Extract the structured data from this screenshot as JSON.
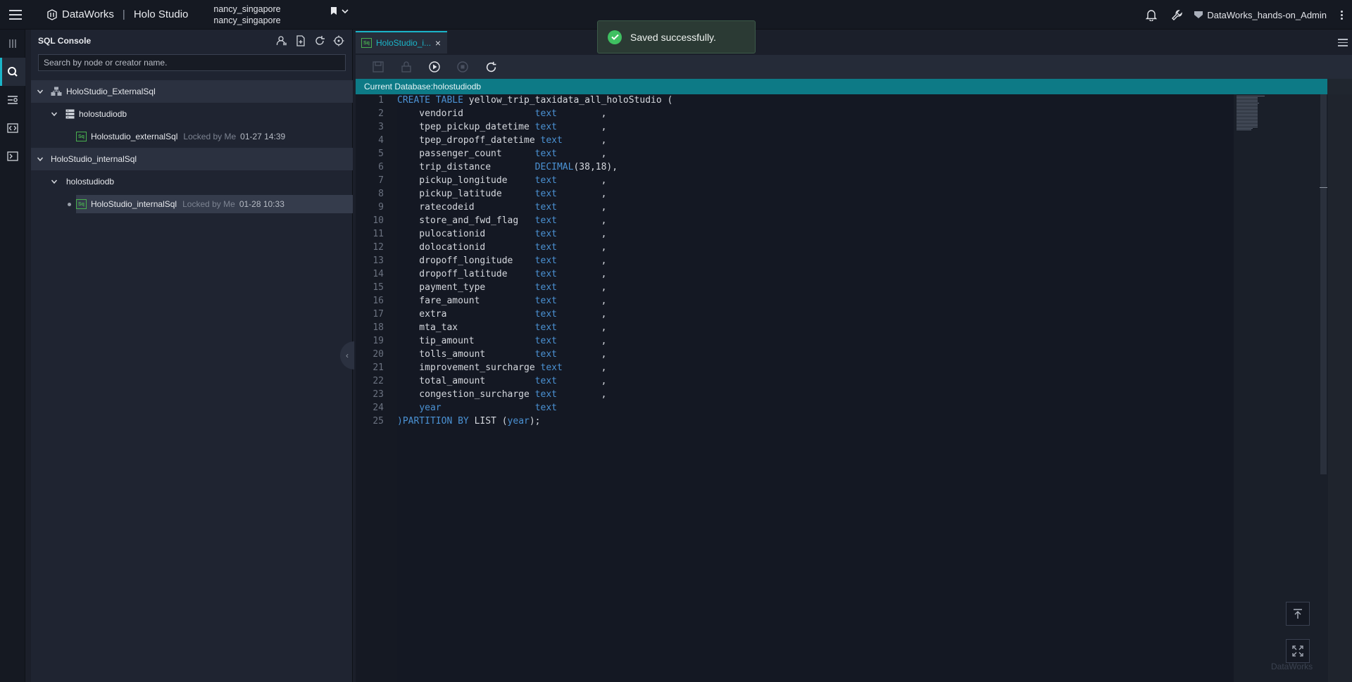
{
  "topbar": {
    "brand": "DataWorks",
    "product": "Holo Studio",
    "workspace_line1": "nancy_singapore",
    "workspace_line2": "nancy_singapore",
    "user": "DataWorks_hands-on_Admin"
  },
  "sidebar": {
    "title": "SQL Console",
    "search_placeholder": "Search by node or creator name."
  },
  "tree": {
    "group1": "HoloStudio_ExternalSql",
    "group1_db": "holostudiodb",
    "group1_file": "Holostudio_externalSql",
    "group1_file_lock": "Locked by Me",
    "group1_file_time": "01-27 14:39",
    "group2": "HoloStudio_internalSql",
    "group2_db": "holostudiodb",
    "group2_file": "HoloStudio_internalSql",
    "group2_file_lock": "Locked by Me",
    "group2_file_time": "01-28 10:33"
  },
  "editor": {
    "tab_label": "HoloStudio_i...",
    "current_database": "Current Database:holostudiodb"
  },
  "toast": {
    "message": "Saved successfully."
  },
  "watermark": "DataWorks",
  "code_lines": [
    {
      "n": "1",
      "parts": [
        {
          "t": "CREATE TABLE",
          "c": "kw"
        },
        {
          "t": " yellow_trip_taxidata_all_holoStudio ("
        }
      ]
    },
    {
      "n": "2",
      "parts": [
        {
          "t": "    vendorid             "
        },
        {
          "t": "text",
          "c": "ty"
        },
        {
          "t": "        ,"
        }
      ]
    },
    {
      "n": "3",
      "parts": [
        {
          "t": "    tpep_pickup_datetime "
        },
        {
          "t": "text",
          "c": "ty"
        },
        {
          "t": "        ,"
        }
      ]
    },
    {
      "n": "4",
      "parts": [
        {
          "t": "    tpep_dropoff_datetime "
        },
        {
          "t": "text",
          "c": "ty"
        },
        {
          "t": "       ,"
        }
      ]
    },
    {
      "n": "5",
      "parts": [
        {
          "t": "    passenger_count      "
        },
        {
          "t": "text",
          "c": "ty"
        },
        {
          "t": "        ,"
        }
      ]
    },
    {
      "n": "6",
      "parts": [
        {
          "t": "    trip_distance        "
        },
        {
          "t": "DECIMAL",
          "c": "ty"
        },
        {
          "t": "(38,18),"
        }
      ]
    },
    {
      "n": "7",
      "parts": [
        {
          "t": "    pickup_longitude     "
        },
        {
          "t": "text",
          "c": "ty"
        },
        {
          "t": "        ,"
        }
      ]
    },
    {
      "n": "8",
      "parts": [
        {
          "t": "    pickup_latitude      "
        },
        {
          "t": "text",
          "c": "ty"
        },
        {
          "t": "        ,"
        }
      ]
    },
    {
      "n": "9",
      "parts": [
        {
          "t": "    ratecodeid           "
        },
        {
          "t": "text",
          "c": "ty"
        },
        {
          "t": "        ,"
        }
      ]
    },
    {
      "n": "10",
      "parts": [
        {
          "t": "    store_and_fwd_flag   "
        },
        {
          "t": "text",
          "c": "ty"
        },
        {
          "t": "        ,"
        }
      ]
    },
    {
      "n": "11",
      "parts": [
        {
          "t": "    pulocationid         "
        },
        {
          "t": "text",
          "c": "ty"
        },
        {
          "t": "        ,"
        }
      ]
    },
    {
      "n": "12",
      "parts": [
        {
          "t": "    dolocationid         "
        },
        {
          "t": "text",
          "c": "ty"
        },
        {
          "t": "        ,"
        }
      ]
    },
    {
      "n": "13",
      "parts": [
        {
          "t": "    dropoff_longitude    "
        },
        {
          "t": "text",
          "c": "ty"
        },
        {
          "t": "        ,"
        }
      ]
    },
    {
      "n": "14",
      "parts": [
        {
          "t": "    dropoff_latitude     "
        },
        {
          "t": "text",
          "c": "ty"
        },
        {
          "t": "        ,"
        }
      ]
    },
    {
      "n": "15",
      "parts": [
        {
          "t": "    payment_type         "
        },
        {
          "t": "text",
          "c": "ty"
        },
        {
          "t": "        ,"
        }
      ]
    },
    {
      "n": "16",
      "parts": [
        {
          "t": "    fare_amount          "
        },
        {
          "t": "text",
          "c": "ty"
        },
        {
          "t": "        ,"
        }
      ]
    },
    {
      "n": "17",
      "parts": [
        {
          "t": "    extra                "
        },
        {
          "t": "text",
          "c": "ty"
        },
        {
          "t": "        ,"
        }
      ]
    },
    {
      "n": "18",
      "parts": [
        {
          "t": "    mta_tax              "
        },
        {
          "t": "text",
          "c": "ty"
        },
        {
          "t": "        ,"
        }
      ]
    },
    {
      "n": "19",
      "parts": [
        {
          "t": "    tip_amount           "
        },
        {
          "t": "text",
          "c": "ty"
        },
        {
          "t": "        ,"
        }
      ]
    },
    {
      "n": "20",
      "parts": [
        {
          "t": "    tolls_amount         "
        },
        {
          "t": "text",
          "c": "ty"
        },
        {
          "t": "        ,"
        }
      ]
    },
    {
      "n": "21",
      "parts": [
        {
          "t": "    improvement_surcharge "
        },
        {
          "t": "text",
          "c": "ty"
        },
        {
          "t": "       ,"
        }
      ]
    },
    {
      "n": "22",
      "parts": [
        {
          "t": "    total_amount         "
        },
        {
          "t": "text",
          "c": "ty"
        },
        {
          "t": "        ,"
        }
      ]
    },
    {
      "n": "23",
      "parts": [
        {
          "t": "    congestion_surcharge "
        },
        {
          "t": "text",
          "c": "ty"
        },
        {
          "t": "        ,"
        }
      ]
    },
    {
      "n": "24",
      "parts": [
        {
          "t": "    "
        },
        {
          "t": "year",
          "c": "ty"
        },
        {
          "t": "                 "
        },
        {
          "t": "text",
          "c": "ty"
        }
      ]
    },
    {
      "n": "25",
      "parts": [
        {
          "t": ")PARTITION BY",
          "c": "kw"
        },
        {
          "t": " LIST ("
        },
        {
          "t": "year",
          "c": "ty"
        },
        {
          "t": ");"
        }
      ]
    }
  ],
  "colors": {
    "accent": "#1bb5c9",
    "db_bar": "#0d7a86",
    "success": "#3fc061",
    "keyword": "#4b92d4"
  }
}
